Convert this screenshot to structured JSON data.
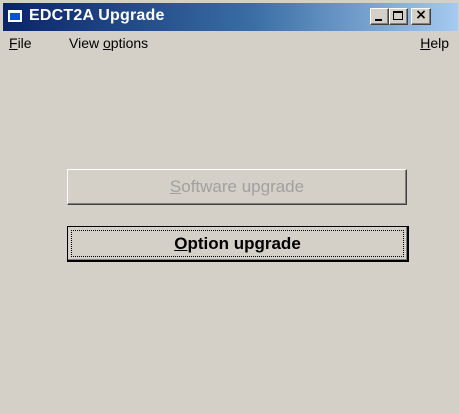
{
  "window": {
    "title": "EDCT2A  Upgrade",
    "title_color": "#ffffff",
    "titlebar_gradient": [
      "#0a246a",
      "#a6caf0"
    ],
    "face_color": "#d4d0c8",
    "controls": {
      "minimize_icon": "minimize-icon",
      "maximize_icon": "maximize-icon",
      "close_icon": "close-icon",
      "close_glyph": "×"
    }
  },
  "menubar": {
    "file": {
      "mnemonic": "F",
      "rest": "ile"
    },
    "view_options": {
      "before": "View ",
      "mnemonic": "o",
      "rest": "ptions"
    },
    "help": {
      "mnemonic": "H",
      "rest": "elp"
    }
  },
  "buttons": {
    "software_upgrade": {
      "mnemonic": "S",
      "rest": "oftware upgrade",
      "enabled": false
    },
    "option_upgrade": {
      "mnemonic": "O",
      "rest": "ption upgrade",
      "enabled": true,
      "focused": true
    }
  }
}
